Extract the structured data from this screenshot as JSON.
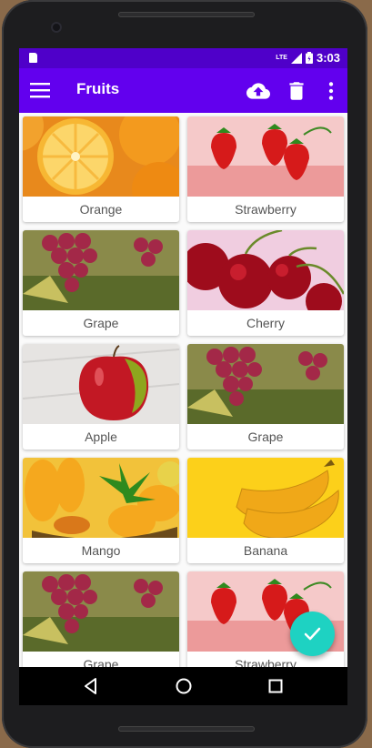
{
  "status_bar": {
    "network": "LTE",
    "time": "3:03",
    "color": "#4f00c9"
  },
  "app_bar": {
    "title": "Fruits",
    "color": "#6200ee",
    "actions": [
      "cloud-upload-icon",
      "delete-icon",
      "more-vert-icon"
    ]
  },
  "fruits": [
    {
      "name": "Orange"
    },
    {
      "name": "Strawberry"
    },
    {
      "name": "Grape"
    },
    {
      "name": "Cherry"
    },
    {
      "name": "Apple"
    },
    {
      "name": "Grape"
    },
    {
      "name": "Mango"
    },
    {
      "name": "Banana"
    },
    {
      "name": "Grape"
    },
    {
      "name": "Strawberry"
    }
  ],
  "fab": {
    "icon": "check-icon",
    "color": "#1ed2c2"
  },
  "nav_bar": [
    "back-icon",
    "home-icon",
    "recents-icon"
  ]
}
